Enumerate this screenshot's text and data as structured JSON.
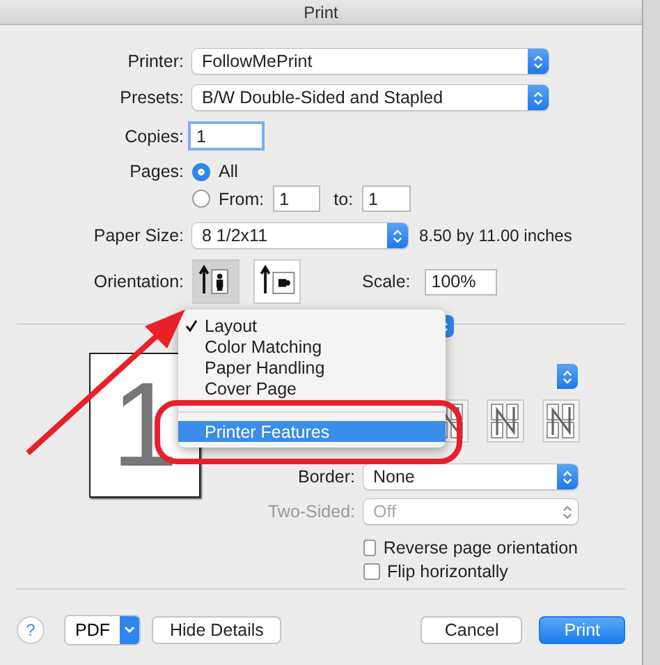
{
  "window": {
    "title": "Print"
  },
  "form": {
    "printer": {
      "label": "Printer:",
      "value": "FollowMePrint"
    },
    "presets": {
      "label": "Presets:",
      "value": "B/W Double-Sided and Stapled"
    },
    "copies": {
      "label": "Copies:",
      "value": "1"
    },
    "pages": {
      "label": "Pages:",
      "options": [
        {
          "label": "All",
          "selected": true
        },
        {
          "label": "From:",
          "selected": false
        }
      ],
      "from": "1",
      "to_label": "to:",
      "to": "1"
    },
    "paper_size": {
      "label": "Paper Size:",
      "value": "8 1/2x11",
      "dimensions": "8.50 by 11.00 inches"
    },
    "orientation": {
      "label": "Orientation:",
      "options": [
        {
          "kind": "portrait",
          "selected": true
        },
        {
          "kind": "landscape",
          "selected": false
        }
      ]
    },
    "scale": {
      "label": "Scale:",
      "value": "100%"
    }
  },
  "preview": {
    "page_number": "1"
  },
  "menu": {
    "items": [
      {
        "kind": "item",
        "label": "Layout",
        "checked": true,
        "selected": false
      },
      {
        "kind": "item",
        "label": "Color Matching",
        "checked": false,
        "selected": false
      },
      {
        "kind": "item",
        "label": "Paper Handling",
        "checked": false,
        "selected": false
      },
      {
        "kind": "item",
        "label": "Cover Page",
        "checked": false,
        "selected": false
      },
      {
        "kind": "separator"
      },
      {
        "kind": "item",
        "label": "Printer Features",
        "checked": false,
        "selected": true
      }
    ]
  },
  "layout": {
    "border": {
      "label": "Border:",
      "value": "None"
    },
    "two_sided": {
      "label": "Two-Sided:",
      "value": "Off",
      "disabled": true
    },
    "checkboxes": [
      {
        "label": "Reverse page orientation",
        "checked": false
      },
      {
        "label": "Flip horizontally",
        "checked": false
      }
    ]
  },
  "footer": {
    "help": "?",
    "pdf": "PDF",
    "hide_details": "Hide Details",
    "cancel": "Cancel",
    "print": "Print"
  }
}
